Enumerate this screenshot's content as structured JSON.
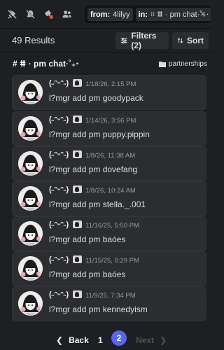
{
  "toolbar": {
    "icons": [
      "pin-slash-icon",
      "mute-slash-icon",
      "notification-icon",
      "members-icon"
    ],
    "search": {
      "chip1_key": "from:",
      "chip1_value": "4lilyy",
      "chip2_key": "in:",
      "chip2_value": "⌗ ⵌ · pm chat·˚₊‧"
    },
    "clear_label": "×"
  },
  "results": {
    "count_label": "49 Results",
    "filters_label": "Filters (2)",
    "sort_label": "Sort"
  },
  "channel": {
    "name": "# ⵌ · pm chat·˚₊‧",
    "category": "partnerships"
  },
  "messages": [
    {
      "user": "(˶ᵔᵕᵔ˶)",
      "time": "1/18/26, 2:15 PM",
      "text": "l?mgr add pm goodypack"
    },
    {
      "user": "(˶ᵔᵕᵔ˶)",
      "time": "1/14/26, 3:56 PM",
      "text": "l?mgr add pm puppy.pippin"
    },
    {
      "user": "(˶ᵔᵕᵔ˶)",
      "time": "1/8/26, 11:38 AM",
      "text": "l?mgr add pm dovefang"
    },
    {
      "user": "(˶ᵔᵕᵔ˶)",
      "time": "1/8/26, 10:24 AM",
      "text": "l?mgr add pm stella._.001"
    },
    {
      "user": "(˶ᵔᵕᵔ˶)",
      "time": "11/16/25, 5:50 PM",
      "text": "l?mgr add pm baóes"
    },
    {
      "user": "(˶ᵔᵕᵔ˶)",
      "time": "11/15/25, 6:29 PM",
      "text": "l?mgr add pm baóes"
    },
    {
      "user": "(˶ᵔᵕᵔ˶)",
      "time": "11/9/25, 7:34 PM",
      "text": "l?mgr add pm kennedyism"
    }
  ],
  "pagination": {
    "back_label": "Back",
    "page1": "1",
    "page2": "2",
    "next_label": "Next",
    "current_page": 2
  },
  "colors": {
    "background": "#1e1f22",
    "card": "#2b2d31",
    "accent": "#5865f2"
  }
}
